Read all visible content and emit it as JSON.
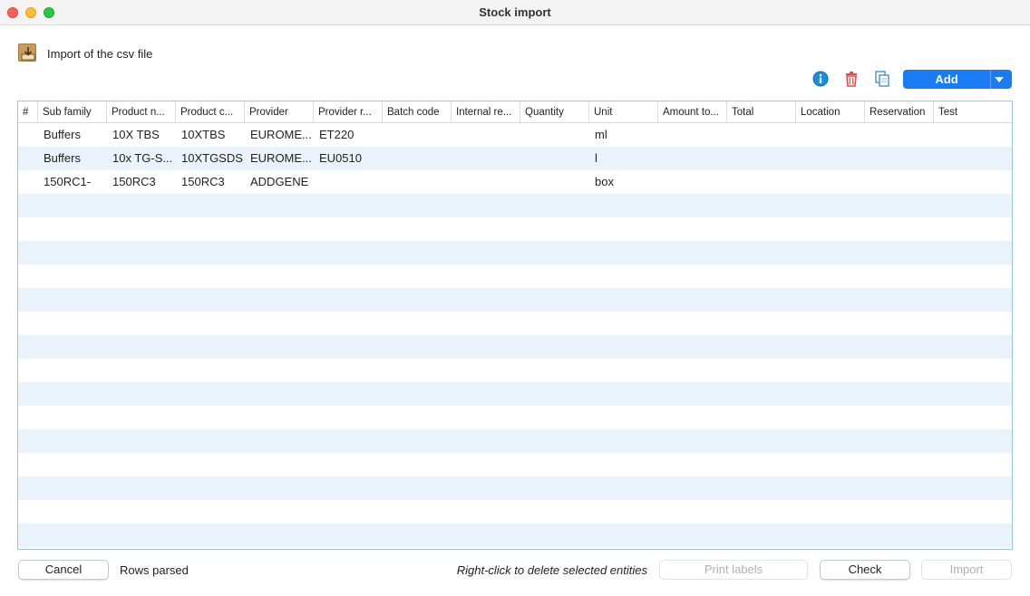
{
  "window": {
    "title": "Stock import"
  },
  "header": {
    "import_label": "Import of the csv file"
  },
  "toolbar": {
    "info_icon": "info-icon",
    "delete_icon": "trash-icon",
    "copy_icon": "copy-icon",
    "add_label": "Add"
  },
  "table": {
    "columns": [
      "#",
      "Sub family",
      "Product n...",
      "Product c...",
      "Provider",
      "Provider r...",
      "Batch code",
      "Internal re...",
      "Quantity",
      "Unit",
      "Amount to...",
      "Total",
      "Location",
      "Reservation",
      "Test"
    ],
    "rows": [
      [
        "",
        "Buffers",
        "10X TBS",
        "10XTBS",
        "EUROME...",
        "ET220",
        "",
        "",
        "",
        "ml",
        "",
        "",
        "",
        "",
        ""
      ],
      [
        "",
        "Buffers",
        "10x TG-S...",
        "10XTGSDS",
        "EUROME...",
        "EU0510",
        "",
        "",
        "",
        "l",
        "",
        "",
        "",
        "",
        ""
      ],
      [
        "",
        "150RC1-",
        "150RC3",
        "150RC3",
        "ADDGENE",
        "",
        "",
        "",
        "",
        "box",
        "",
        "",
        "",
        "",
        ""
      ]
    ]
  },
  "footer": {
    "cancel_label": "Cancel",
    "rows_parsed": "Rows parsed",
    "hint": "Right-click to delete selected entities",
    "print_label": "Print labels",
    "check_label": "Check",
    "import_label": "Import"
  },
  "colors": {
    "accent": "#1a7cf5",
    "row_alt": "#eaf3fb",
    "table_border": "#9cc5e8"
  }
}
